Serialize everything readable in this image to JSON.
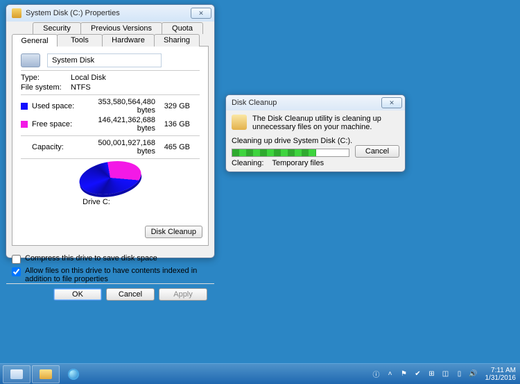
{
  "props": {
    "title": "System Disk (C:) Properties",
    "tabs": {
      "security": "Security",
      "previous_versions": "Previous Versions",
      "quota": "Quota",
      "general": "General",
      "tools": "Tools",
      "hardware": "Hardware",
      "sharing": "Sharing"
    },
    "disk_name": "System Disk",
    "type_label": "Type:",
    "type_value": "Local Disk",
    "fs_label": "File system:",
    "fs_value": "NTFS",
    "used_label": "Used space:",
    "used_bytes": "353,580,564,480 bytes",
    "used_gb": "329 GB",
    "free_label": "Free space:",
    "free_bytes": "146,421,362,688 bytes",
    "free_gb": "136 GB",
    "cap_label": "Capacity:",
    "cap_bytes": "500,001,927,168 bytes",
    "cap_gb": "465 GB",
    "drive_caption": "Drive C:",
    "disk_cleanup_btn": "Disk Cleanup",
    "compress_label": "Compress this drive to save disk space",
    "index_label": "Allow files on this drive to have contents indexed in addition to file properties",
    "ok": "OK",
    "cancel": "Cancel",
    "apply": "Apply"
  },
  "cleanup": {
    "title": "Disk Cleanup",
    "msg": "The Disk Cleanup utility is cleaning up unnecessary files on your machine.",
    "progress_label": "Cleaning up drive System Disk (C:).",
    "status_label": "Cleaning:",
    "status_value": "Temporary files",
    "cancel": "Cancel"
  },
  "taskbar": {
    "time": "7:11 AM",
    "date": "1/31/2016"
  },
  "chart_data": {
    "type": "pie",
    "title": "Drive C:",
    "series": [
      {
        "name": "Used space",
        "value": 329,
        "unit": "GB",
        "color": "#120eff"
      },
      {
        "name": "Free space",
        "value": 136,
        "unit": "GB",
        "color": "#f319e6"
      }
    ]
  }
}
